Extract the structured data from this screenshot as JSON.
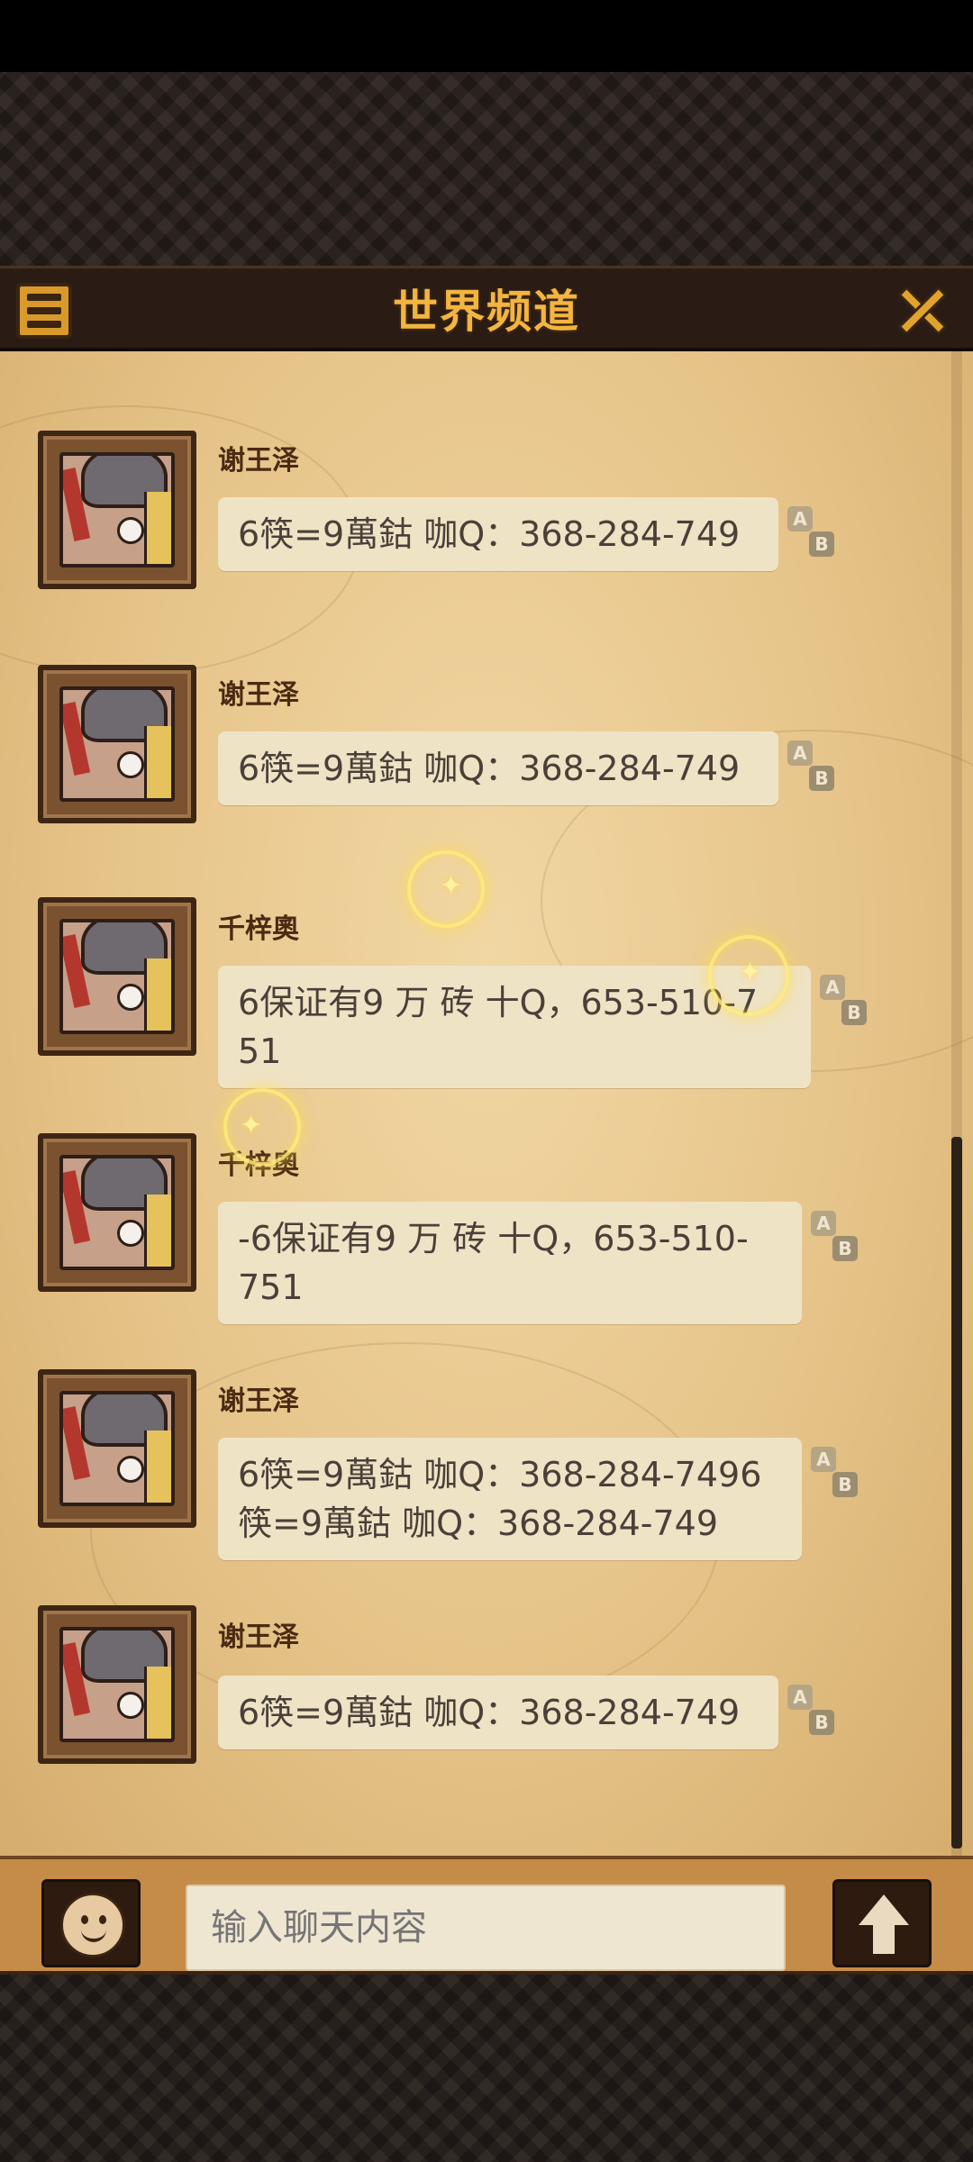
{
  "header": {
    "title": "世界频道"
  },
  "messages": [
    {
      "sender": "谢王泽",
      "text": "6筷=9萬鈷 咖Q：368-284-749"
    },
    {
      "sender": "谢王泽",
      "text": "6筷=9萬鈷 咖Q：368-284-749"
    },
    {
      "sender": "千梓奧",
      "line1": "6保证有9 万 砖 十Q，653-510-7",
      "line2": "51"
    },
    {
      "sender": "千梓奧",
      "line1": "-6保证有9 万 砖 十Q，653-510-",
      "line2": "751"
    },
    {
      "sender": "谢王泽",
      "line1": "6筷=9萬鈷 咖Q：368-284-7496",
      "line2": "筷=9萬鈷 咖Q：368-284-749"
    },
    {
      "sender": "谢王泽",
      "text": "6筷=9萬鈷 咖Q：368-284-749"
    }
  ],
  "translate_icon": {
    "a": "A",
    "b": "B"
  },
  "input": {
    "placeholder": "输入聊天内容"
  },
  "colors": {
    "title": "#f2b540",
    "header_bg": "#2a1c14",
    "parchment": "#e6c489",
    "bubble": "#efe3c6",
    "input_bar": "#c58b48"
  }
}
